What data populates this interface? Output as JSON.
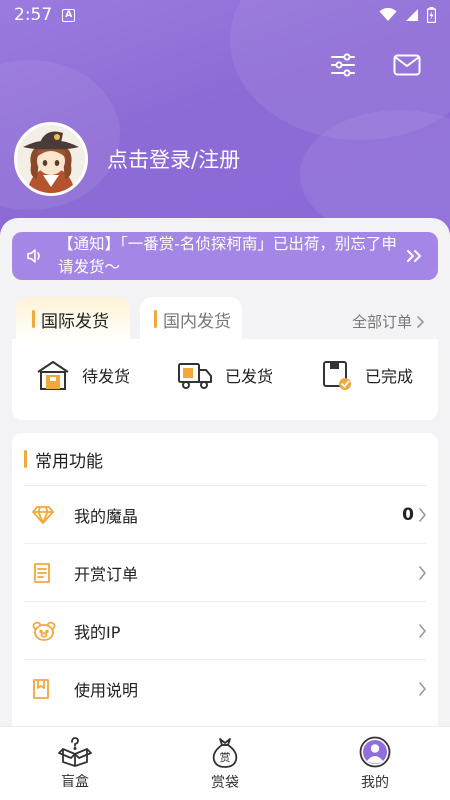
{
  "status": {
    "time": "2:57",
    "a_badge": "A"
  },
  "header": {
    "login_text": "点击登录/注册",
    "icons": [
      "settings-sliders-icon",
      "mail-icon"
    ]
  },
  "notice": {
    "text": "【通知】「一番赏-名侦探柯南」已出荷，别忘了申请发货～"
  },
  "orders": {
    "tabs": [
      {
        "label": "国际发货",
        "active": true
      },
      {
        "label": "国内发货",
        "active": false
      }
    ],
    "all_label": "全部订单",
    "statuses": [
      {
        "label": "待发货",
        "icon": "warehouse-icon"
      },
      {
        "label": "已发货",
        "icon": "delivery-truck-icon"
      },
      {
        "label": "已完成",
        "icon": "completed-box-icon"
      }
    ]
  },
  "common": {
    "title": "常用功能",
    "items": [
      {
        "label": "我的魔晶",
        "value": "0",
        "icon": "diamond-icon"
      },
      {
        "label": "开赏订单",
        "value": "",
        "icon": "receipt-icon"
      },
      {
        "label": "我的IP",
        "value": "",
        "icon": "bear-icon"
      },
      {
        "label": "使用说明",
        "value": "",
        "icon": "book-icon"
      }
    ]
  },
  "tabbar": {
    "items": [
      {
        "label": "盲盒",
        "icon": "mystery-box-icon"
      },
      {
        "label": "赏袋",
        "icon": "reward-bag-icon",
        "badge": "赏"
      },
      {
        "label": "我的",
        "icon": "profile-icon"
      }
    ]
  },
  "colors": {
    "accent": "#8f6fdc",
    "notice": "#a486e6",
    "marker": "#f2a83c"
  }
}
